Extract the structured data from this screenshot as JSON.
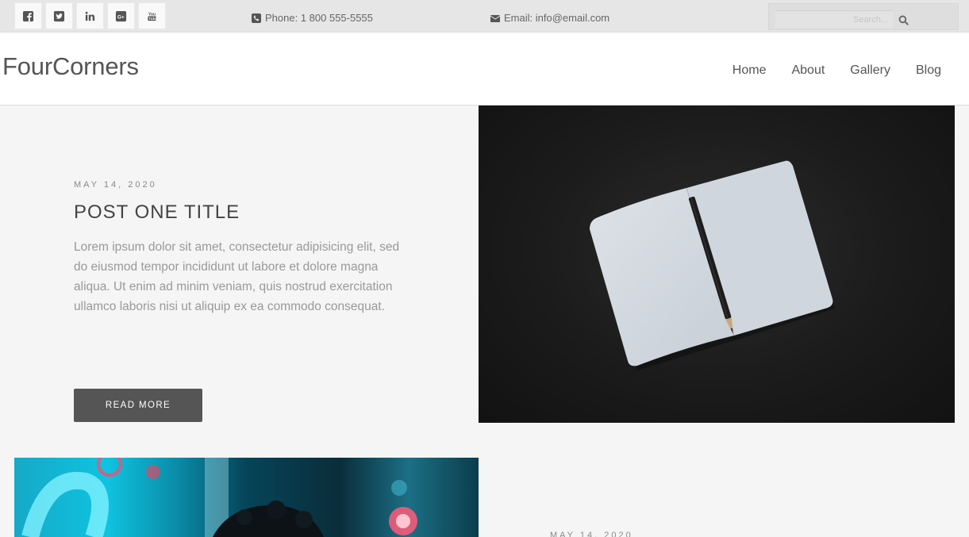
{
  "topbar": {
    "social": [
      {
        "name": "facebook",
        "icon": "facebook-icon"
      },
      {
        "name": "twitter",
        "icon": "twitter-icon"
      },
      {
        "name": "linkedin",
        "icon": "linkedin-icon"
      },
      {
        "name": "google-plus",
        "icon": "google-plus-icon"
      },
      {
        "name": "youtube",
        "icon": "youtube-icon"
      }
    ],
    "phone": "Phone: 1 800 555-5555",
    "email": "Email: info@email.com",
    "search_placeholder": "Search..."
  },
  "header": {
    "brand": "FourCorners",
    "nav": [
      "Home",
      "About",
      "Gallery",
      "Blog"
    ]
  },
  "posts": [
    {
      "date": "MAY 14, 2020",
      "title": "POST ONE TITLE",
      "excerpt": "Lorem ipsum dolor sit amet, consectetur adipisicing elit, sed do eiusmod tempor incididunt ut labore et dolore magna aliqua. Ut enim ad minim veniam, quis nostrud exercitation ullamco laboris nisi ut aliquip ex ea commodo consequat.",
      "button": "READ MORE"
    },
    {
      "date": "MAY 14, 2020"
    }
  ],
  "colors": {
    "topbar_bg": "#e6e6e6",
    "page_bg": "#f5f5f5",
    "button_bg": "#555555",
    "text": "#555555"
  }
}
